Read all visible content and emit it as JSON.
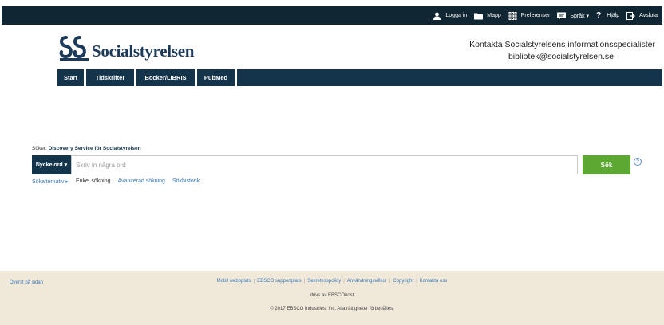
{
  "colors": {
    "topbar": "#112633",
    "nav": "#14344c",
    "search_button": "#5ca832",
    "link": "#3b78b6",
    "footer": "#f0e9da"
  },
  "topbar": {
    "items": [
      {
        "icon": "user-icon",
        "label": "Logga in"
      },
      {
        "icon": "folder-icon",
        "label": "Mapp"
      },
      {
        "icon": "preferences-icon",
        "label": "Preferenser"
      },
      {
        "icon": "language-icon",
        "label": "Språk ▾"
      },
      {
        "icon": "help-icon",
        "label": "Hjälp"
      },
      {
        "icon": "exit-icon",
        "label": "Avsluta"
      }
    ]
  },
  "header": {
    "logo_text": "Socialstyrelsen",
    "contact_line1": "Kontakta Socialstyrelsens informationsspecialister",
    "contact_email": "bibliotek@socialstyrelsen.se"
  },
  "nav": {
    "tabs": [
      {
        "label": "Start"
      },
      {
        "label": "Tidskrifter"
      },
      {
        "label": "Böcker/LIBRIS"
      },
      {
        "label": "PubMed"
      }
    ]
  },
  "search": {
    "label_prefix": "Söker:",
    "label_target": "Discovery Service för Socialstyrelsen",
    "field_select": "Nyckelord ▾",
    "placeholder": "Skriv in några ord",
    "button": "Sök",
    "help": "?",
    "options": {
      "search_options": "Sökalternativ ▸",
      "basic": "Enkel sökning",
      "advanced": "Avancerad sökning",
      "history": "Sökhistorik"
    }
  },
  "footer": {
    "top_link": "Överst på sidan",
    "links": [
      "Mobil webbplats",
      "EBSCO supportplats",
      "Sekretesspolicy",
      "Användningsvillkor",
      "Copyright",
      "Kontakta oss"
    ],
    "powered_prefix": "drivs av EBSCO",
    "powered_host": "host",
    "copyright": "© 2017 EBSCO Industries, Inc. Alla rättigheter förbehålles."
  }
}
